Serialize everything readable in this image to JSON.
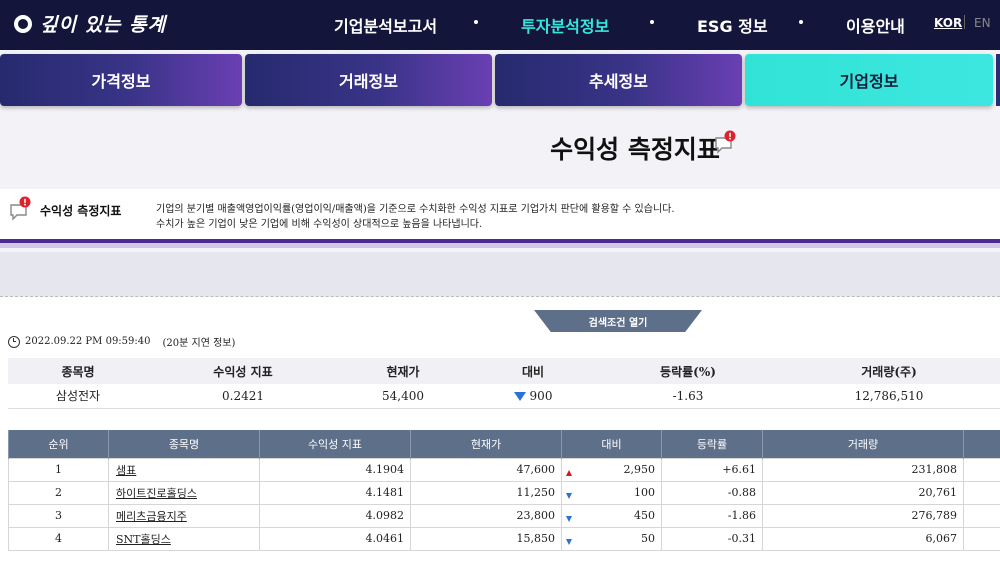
{
  "logo": {
    "text": "깊이 있는 통계"
  },
  "nav": {
    "items": [
      "기업분석보고서",
      "투자분석정보",
      "ESG 정보",
      "이용안내"
    ],
    "active_index": 1,
    "lang": {
      "kor": "KOR",
      "en": "EN"
    }
  },
  "tabs": [
    "가격정보",
    "거래정보",
    "추세정보",
    "기업정보"
  ],
  "page": {
    "title": "수익성 측정지표"
  },
  "info": {
    "label": "수익성 측정지표",
    "desc_line1": "기업의 분기별 매출액영업이익률(영업이익/매출액)을 기준으로 수치화한 수익성 지표로 기업가치 판단에 활용할 수 있습니다.",
    "desc_line2": "수치가 높은 기업이 낮은 기업에 비해 수익성이 상대적으로 높음을 나타냅니다."
  },
  "search_toggle": "검색조건 열기",
  "timestamp": {
    "datetime": "2022.09.22 PM 09:59:40",
    "delay": "(20분 지연 정보)"
  },
  "summary": {
    "headers": [
      "종목명",
      "수익성 지표",
      "현재가",
      "대비",
      "등락률(%)",
      "거래량(주)"
    ],
    "row": {
      "name": "삼성전자",
      "index": "0.2421",
      "price": "54,400",
      "change": "900",
      "rate": "-1.63",
      "volume": "12,786,510"
    }
  },
  "ranking": {
    "headers": [
      "순위",
      "종목명",
      "수익성 지표",
      "현재가",
      "대비",
      "등락률",
      "거래량",
      ""
    ],
    "rows": [
      {
        "rank": "1",
        "name": "샘표",
        "index": "4.1904",
        "price": "47,600",
        "dir": "up",
        "change": "2,950",
        "rate": "+6.61",
        "volume": "231,808"
      },
      {
        "rank": "2",
        "name": "하이트진로홀딩스",
        "index": "4.1481",
        "price": "11,250",
        "dir": "down",
        "change": "100",
        "rate": "-0.88",
        "volume": "20,761"
      },
      {
        "rank": "3",
        "name": "메리츠금융지주",
        "index": "4.0982",
        "price": "23,800",
        "dir": "down",
        "change": "450",
        "rate": "-1.86",
        "volume": "276,789"
      },
      {
        "rank": "4",
        "name": "SNT홀딩스",
        "index": "4.0461",
        "price": "15,850",
        "dir": "down",
        "change": "50",
        "rate": "-0.31",
        "volume": "6,067"
      }
    ]
  },
  "colors": {
    "navy": "#13153a",
    "accent": "#35e6dc",
    "up": "#d9141b",
    "down": "#1f4fc7",
    "header": "#5e6f8a"
  }
}
